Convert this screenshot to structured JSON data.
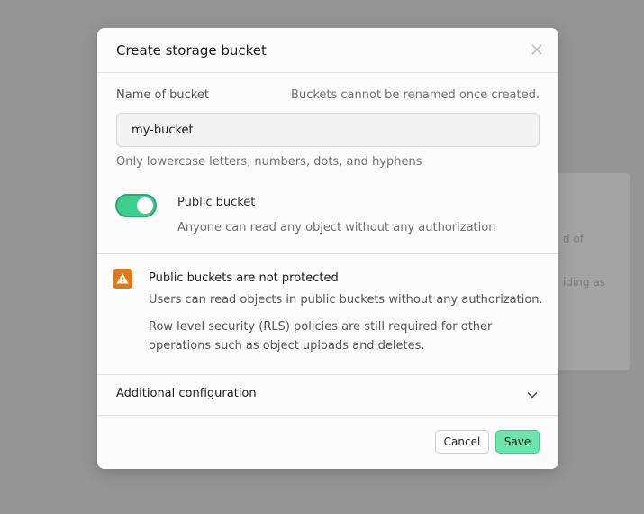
{
  "background": {
    "fragment_1": "d of",
    "fragment_2": "iding as"
  },
  "modal": {
    "title": "Create storage bucket",
    "close_icon": "close-icon",
    "name_label": "Name of bucket",
    "name_hint": "Buckets cannot be renamed once created.",
    "name_value": "my-bucket",
    "name_help": "Only lowercase letters, numbers, dots, and hyphens",
    "public_toggle": {
      "label": "Public bucket",
      "description": "Anyone can read any object without any authorization",
      "checked": true,
      "color": "#3ecf8e"
    },
    "warning": {
      "icon": "warning-triangle-icon",
      "color": "#d97a1c",
      "title": "Public buckets are not protected",
      "line1": "Users can read objects in public buckets without any authorization.",
      "line2": "Row level security (RLS) policies are still required for other operations such as object uploads and deletes."
    },
    "additional_config": {
      "label": "Additional configuration",
      "icon": "chevron-down-icon"
    },
    "footer": {
      "cancel_label": "Cancel",
      "save_label": "Save"
    }
  }
}
